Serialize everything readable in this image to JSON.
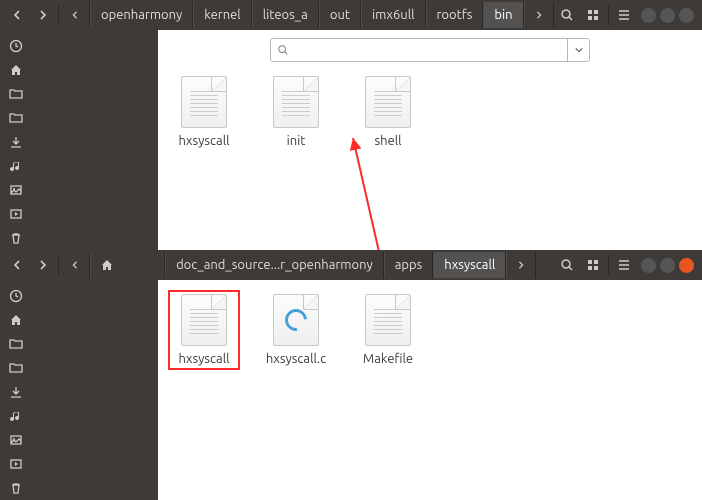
{
  "win1": {
    "breadcrumb": [
      "openharmony",
      "kernel",
      "liteos_a",
      "out",
      "imx6ull",
      "rootfs",
      "bin"
    ],
    "active_crumb": 6,
    "sidebar": [
      "Recent",
      "Home",
      "Desktop",
      "Documents",
      "Downloads",
      "Music",
      "Pictures",
      "Videos",
      "Trash"
    ],
    "files": [
      {
        "name": "hxsyscall",
        "icon": "text"
      },
      {
        "name": "init",
        "icon": "text"
      },
      {
        "name": "shell",
        "icon": "text"
      }
    ],
    "search_placeholder": ""
  },
  "win2": {
    "home_label": "Home",
    "breadcrumb": [
      "doc_and_source...r_openharmony",
      "apps",
      "hxsyscall"
    ],
    "active_crumb": 2,
    "sidebar": [
      "Recent",
      "Home",
      "Desktop",
      "Documents",
      "Downloads",
      "Music",
      "Pictures",
      "Videos",
      "Trash"
    ],
    "files": [
      {
        "name": "hxsyscall",
        "icon": "text",
        "hl": true
      },
      {
        "name": "hxsyscall.c",
        "icon": "c"
      },
      {
        "name": "Makefile",
        "icon": "text"
      }
    ]
  },
  "side_icons": [
    "clock",
    "home",
    "folder",
    "folder",
    "download",
    "music",
    "picture",
    "video",
    "trash"
  ]
}
